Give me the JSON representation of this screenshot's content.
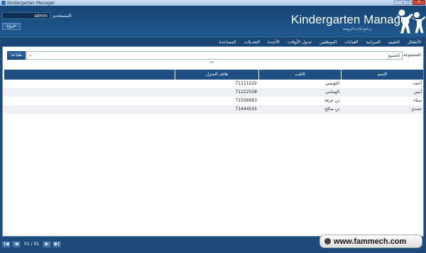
{
  "window": {
    "title": "Kindergarten Manager",
    "minimize": "–",
    "maximize": "□",
    "close": "✕"
  },
  "header": {
    "user_value": "admin",
    "user_label": "المستخدم:",
    "logout_label": "خروج",
    "app_title": "Kindergarten Manager",
    "app_subtitle": "برنامج إدارة الروضة"
  },
  "nav": {
    "items": [
      "الأطفال",
      "التقييم",
      "الميزانية",
      "الغيابات",
      "الموظفين",
      "جدول الأوقات",
      "الأجندة",
      "التعديلات",
      "المساعدة"
    ]
  },
  "filter": {
    "group_label": "المجموعة:",
    "group_value": "الجميع",
    "print_label": "طباعة"
  },
  "grid": {
    "columns": {
      "name": "الإسم",
      "last": "اللقب",
      "phone": "هاتف المنزل"
    },
    "rows": [
      {
        "name": "أحمد",
        "last": "التونسي",
        "phone": "71111222"
      },
      {
        "name": "أيمن",
        "last": "الهمامي",
        "phone": "71222558"
      },
      {
        "name": "سناء",
        "last": "بن عرفة",
        "phone": "71556993"
      },
      {
        "name": "حمدي",
        "last": "بن صالح",
        "phone": "71444555"
      }
    ]
  },
  "pager": {
    "info": "01 / 01",
    "first": "|◀",
    "prev": "◀",
    "next": "▶",
    "last": "▶|"
  },
  "watermark": {
    "text": "www.fammech.com"
  },
  "icons": {
    "collapse": "chevron-double-down-icon",
    "dropdown": "chevron-down-icon",
    "logo": "kids-logo"
  }
}
